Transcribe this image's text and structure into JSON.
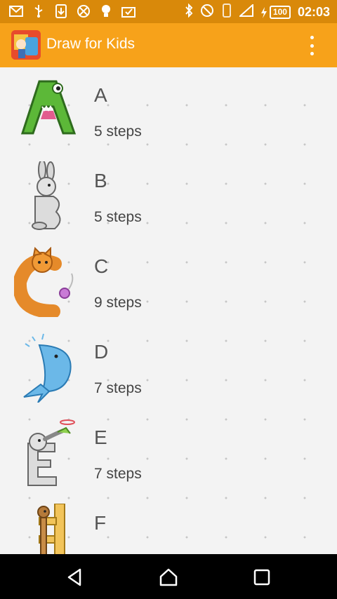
{
  "status_bar": {
    "battery": "100",
    "time": "02:03",
    "icons": [
      "gmail-icon",
      "usb-icon",
      "download-icon",
      "dnd-icon",
      "idea-icon",
      "inbox-icon",
      "bluetooth-icon",
      "blocked-icon",
      "vibrate-icon",
      "signal-icon",
      "battery-icon"
    ]
  },
  "app_bar": {
    "title": "Draw for Kids"
  },
  "lessons": [
    {
      "letter": "A",
      "steps": "5 steps",
      "thumbnail": "crocodile-a"
    },
    {
      "letter": "B",
      "steps": "5 steps",
      "thumbnail": "rabbit-b"
    },
    {
      "letter": "C",
      "steps": "9 steps",
      "thumbnail": "cat-c"
    },
    {
      "letter": "D",
      "steps": "7 steps",
      "thumbnail": "dolphin-d"
    },
    {
      "letter": "E",
      "steps": "7 steps",
      "thumbnail": "elephant-e"
    },
    {
      "letter": "F",
      "steps": "",
      "thumbnail": "giraffe-f"
    }
  ],
  "nav_bar": {
    "buttons": [
      "back-icon",
      "home-icon",
      "recents-icon"
    ]
  },
  "colors": {
    "status_bar": "#d9890a",
    "app_bar": "#f7a21a",
    "background": "#f3f3f3"
  }
}
